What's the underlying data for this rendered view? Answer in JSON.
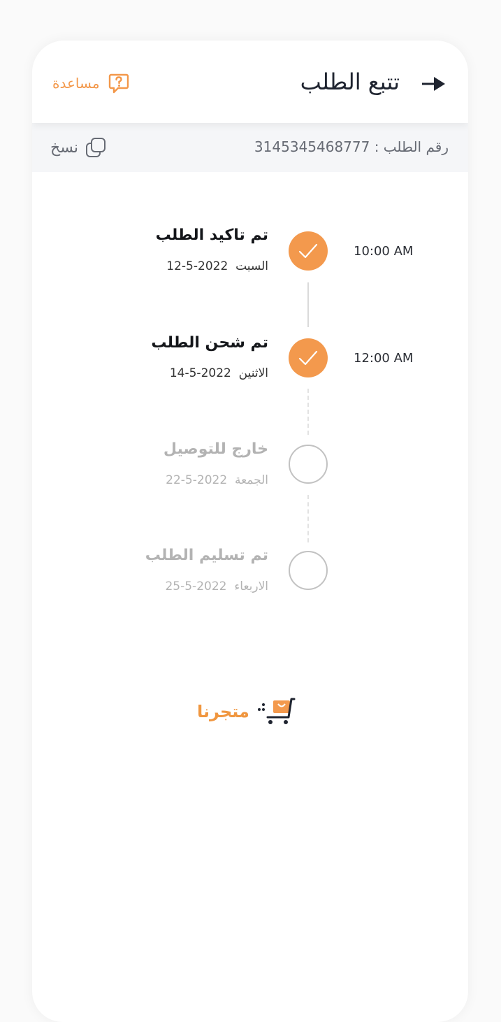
{
  "header": {
    "title": "تتبع الطلب",
    "help_label": "مساعدة"
  },
  "order": {
    "number_text": "رقم الطلب : 3145345468777",
    "copy_label": "نسخ"
  },
  "timeline": [
    {
      "title": "تم تاكيد الطلب",
      "day": "السبت",
      "date": "2022-5-12",
      "time": "10:00 AM",
      "status": "done"
    },
    {
      "title": "تم شحن الطلب",
      "day": "الاثنين",
      "date": "2022-5-14",
      "time": "12:00 AM",
      "status": "done"
    },
    {
      "title": "خارج للتوصيل",
      "day": "الجمعة",
      "date": "2022-5-22",
      "time": "",
      "status": "pending"
    },
    {
      "title": "تم تسليم الطلب",
      "day": "الاربعاء",
      "date": "2022-5-25",
      "time": "",
      "status": "pending"
    }
  ],
  "brand": {
    "name": "متجرنا",
    "accent_color": "#f3994d",
    "dark_color": "#1f2430"
  }
}
